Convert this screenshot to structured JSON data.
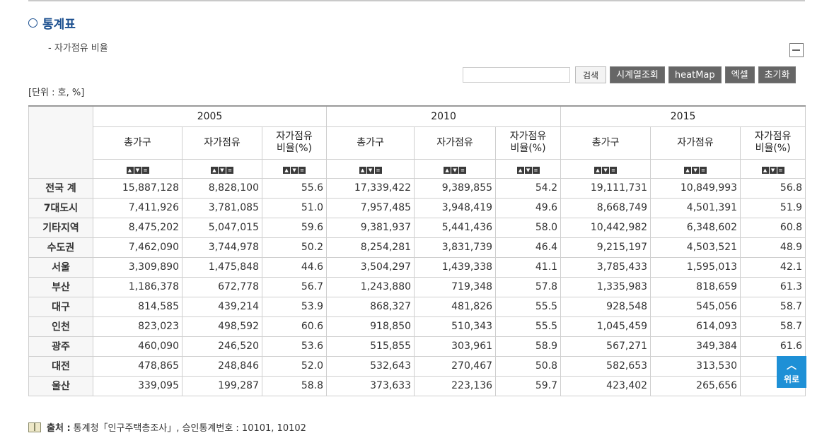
{
  "section_title": "통계표",
  "subtitle": "- 자가점유 비율",
  "toolbar": {
    "search_placeholder": "",
    "search_label": "검색",
    "timeseries_label": "시계열조회",
    "heatmap_label": "heatMap",
    "excel_label": "엑셀",
    "reset_label": "초기화"
  },
  "unit": "[단위 : 호, %]",
  "table": {
    "years": [
      "2005",
      "2010",
      "2015"
    ],
    "columns": [
      {
        "line1": "총가구",
        "line2": ""
      },
      {
        "line1": "자가점유",
        "line2": ""
      },
      {
        "line1": "자가점유",
        "line2": "비율(%)"
      }
    ],
    "rows": [
      {
        "name": "전국 계",
        "values": [
          "15,887,128",
          "8,828,100",
          "55.6",
          "17,339,422",
          "9,389,855",
          "54.2",
          "19,111,731",
          "10,849,993",
          "56.8"
        ]
      },
      {
        "name": "7대도시",
        "values": [
          "7,411,926",
          "3,781,085",
          "51.0",
          "7,957,485",
          "3,948,419",
          "49.6",
          "8,668,749",
          "4,501,391",
          "51.9"
        ]
      },
      {
        "name": "기타지역",
        "values": [
          "8,475,202",
          "5,047,015",
          "59.6",
          "9,381,937",
          "5,441,436",
          "58.0",
          "10,442,982",
          "6,348,602",
          "60.8"
        ]
      },
      {
        "name": "수도권",
        "values": [
          "7,462,090",
          "3,744,978",
          "50.2",
          "8,254,281",
          "3,831,739",
          "46.4",
          "9,215,197",
          "4,503,521",
          "48.9"
        ]
      },
      {
        "name": "서울",
        "values": [
          "3,309,890",
          "1,475,848",
          "44.6",
          "3,504,297",
          "1,439,338",
          "41.1",
          "3,785,433",
          "1,595,013",
          "42.1"
        ]
      },
      {
        "name": "부산",
        "values": [
          "1,186,378",
          "672,778",
          "56.7",
          "1,243,880",
          "719,348",
          "57.8",
          "1,335,983",
          "818,659",
          "61.3"
        ]
      },
      {
        "name": "대구",
        "values": [
          "814,585",
          "439,214",
          "53.9",
          "868,327",
          "481,826",
          "55.5",
          "928,548",
          "545,056",
          "58.7"
        ]
      },
      {
        "name": "인천",
        "values": [
          "823,023",
          "498,592",
          "60.6",
          "918,850",
          "510,343",
          "55.5",
          "1,045,459",
          "614,093",
          "58.7"
        ]
      },
      {
        "name": "광주",
        "values": [
          "460,090",
          "246,520",
          "53.6",
          "515,855",
          "303,961",
          "58.9",
          "567,271",
          "349,384",
          "61.6"
        ]
      },
      {
        "name": "대전",
        "values": [
          "478,865",
          "248,846",
          "52.0",
          "532,643",
          "270,467",
          "50.8",
          "582,653",
          "313,530",
          ""
        ]
      },
      {
        "name": "울산",
        "values": [
          "339,095",
          "199,287",
          "58.8",
          "373,633",
          "223,136",
          "59.7",
          "423,402",
          "265,656",
          ""
        ]
      }
    ]
  },
  "source": {
    "label": "출처 :",
    "text": "통계청「인구주택총조사」, 승인통계번호 : 10101, 10102"
  },
  "scroll_top_label": "위로"
}
